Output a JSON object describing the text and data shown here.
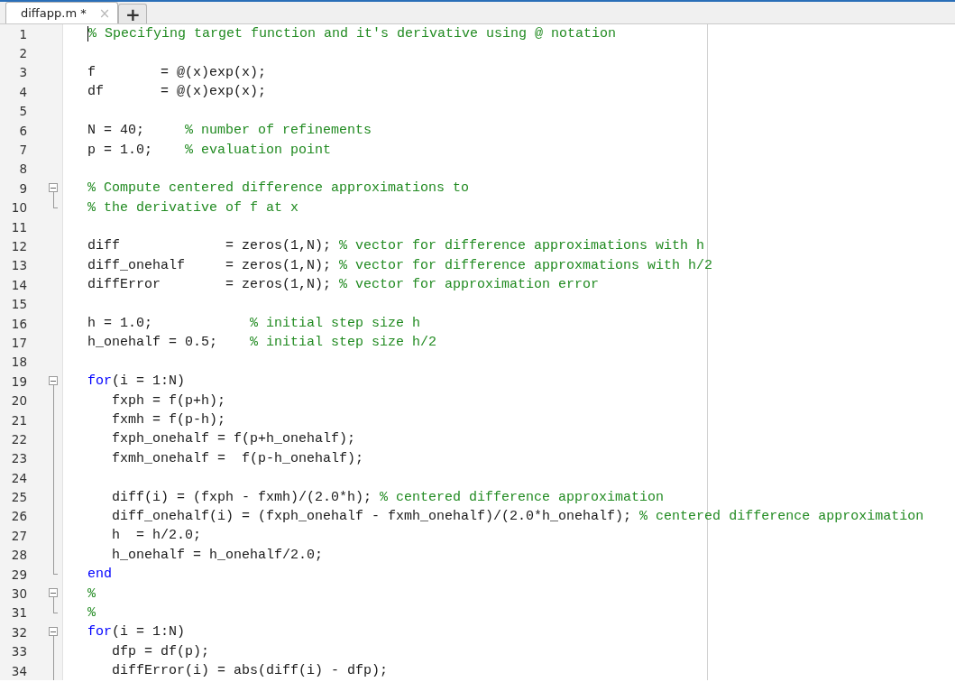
{
  "tabs": [
    {
      "label": "diffapp.m *",
      "selected": true,
      "close": "×"
    }
  ],
  "new_tab": "+",
  "lines": [
    {
      "number": "1",
      "cursor": true,
      "segments": [
        {
          "kind": "comment",
          "text": "% Specifying target function and it's derivative using @ notation"
        }
      ]
    },
    {
      "number": "2"
    },
    {
      "number": "3",
      "segments": [
        {
          "kind": "code",
          "text": "f        = @(x)exp(x);"
        }
      ]
    },
    {
      "number": "4",
      "segments": [
        {
          "kind": "code",
          "text": "df       = @(x)exp(x);"
        }
      ]
    },
    {
      "number": "5"
    },
    {
      "number": "6",
      "segments": [
        {
          "kind": "code",
          "text": "N = 40;     "
        },
        {
          "kind": "comment",
          "text": "% number of refinements"
        }
      ]
    },
    {
      "number": "7",
      "segments": [
        {
          "kind": "code",
          "text": "p = 1.0;    "
        },
        {
          "kind": "comment",
          "text": "% evaluation point"
        }
      ]
    },
    {
      "number": "8"
    },
    {
      "number": "9",
      "kind": "foldstart",
      "segments": [
        {
          "kind": "comment",
          "text": "% Compute centered difference approximations to"
        }
      ]
    },
    {
      "number": "10",
      "kind": "foldend",
      "segments": [
        {
          "kind": "comment",
          "text": "% the derivative of f at x"
        }
      ]
    },
    {
      "number": "11"
    },
    {
      "number": "12",
      "segments": [
        {
          "kind": "code",
          "text": "diff             = zeros(1,N); "
        },
        {
          "kind": "comment",
          "text": "% vector for difference approximations with h"
        }
      ]
    },
    {
      "number": "13",
      "segments": [
        {
          "kind": "code",
          "text": "diff_onehalf     = zeros(1,N); "
        },
        {
          "kind": "comment",
          "text": "% vector for difference approxmations with h/2"
        }
      ]
    },
    {
      "number": "14",
      "segments": [
        {
          "kind": "code",
          "text": "diffError        = zeros(1,N); "
        },
        {
          "kind": "comment",
          "text": "% vector for approximation error"
        }
      ]
    },
    {
      "number": "15"
    },
    {
      "number": "16",
      "segments": [
        {
          "kind": "code",
          "text": "h = 1.0;            "
        },
        {
          "kind": "comment",
          "text": "% initial step size h"
        }
      ]
    },
    {
      "number": "17",
      "segments": [
        {
          "kind": "code",
          "text": "h_onehalf = 0.5;    "
        },
        {
          "kind": "comment",
          "text": "% initial step size h/2"
        }
      ]
    },
    {
      "number": "18"
    },
    {
      "number": "19",
      "kind": "foldstart",
      "segments": [
        {
          "kind": "keyword",
          "text": "for"
        },
        {
          "kind": "code",
          "text": "(i = 1:N)"
        }
      ]
    },
    {
      "number": "20",
      "kind": "foldmid",
      "segments": [
        {
          "kind": "code",
          "text": "   fxph = f(p+h);"
        }
      ]
    },
    {
      "number": "21",
      "kind": "foldmid",
      "segments": [
        {
          "kind": "code",
          "text": "   fxmh = f(p-h);"
        }
      ]
    },
    {
      "number": "22",
      "kind": "foldmid",
      "segments": [
        {
          "kind": "code",
          "text": "   fxph_onehalf = f(p+h_onehalf);"
        }
      ]
    },
    {
      "number": "23",
      "kind": "foldmid",
      "segments": [
        {
          "kind": "code",
          "text": "   fxmh_onehalf =  f(p-h_onehalf);"
        }
      ]
    },
    {
      "number": "24",
      "kind": "foldmid"
    },
    {
      "number": "25",
      "kind": "foldmid",
      "segments": [
        {
          "kind": "code",
          "text": "   diff(i) = (fxph - fxmh)/(2.0*h); "
        },
        {
          "kind": "comment",
          "text": "% centered difference approximation"
        }
      ]
    },
    {
      "number": "26",
      "kind": "foldmid",
      "segments": [
        {
          "kind": "code",
          "text": "   diff_onehalf(i) = (fxph_onehalf - fxmh_onehalf)/(2.0*h_onehalf); "
        },
        {
          "kind": "comment",
          "text": "% centered difference approximation"
        }
      ]
    },
    {
      "number": "27",
      "kind": "foldmid",
      "segments": [
        {
          "kind": "code",
          "text": "   h  = h/2.0;"
        }
      ]
    },
    {
      "number": "28",
      "kind": "foldmid",
      "segments": [
        {
          "kind": "code",
          "text": "   h_onehalf = h_onehalf/2.0;"
        }
      ]
    },
    {
      "number": "29",
      "kind": "foldend",
      "segments": [
        {
          "kind": "keyword",
          "text": "end"
        }
      ]
    },
    {
      "number": "30",
      "kind": "foldstart",
      "segments": [
        {
          "kind": "comment",
          "text": "%"
        }
      ]
    },
    {
      "number": "31",
      "kind": "foldend",
      "segments": [
        {
          "kind": "comment",
          "text": "%"
        }
      ]
    },
    {
      "number": "32",
      "kind": "foldstart",
      "segments": [
        {
          "kind": "keyword",
          "text": "for"
        },
        {
          "kind": "code",
          "text": "(i = 1:N)"
        }
      ]
    },
    {
      "number": "33",
      "kind": "foldmid",
      "segments": [
        {
          "kind": "code",
          "text": "   dfp = df(p);"
        }
      ]
    },
    {
      "number": "34",
      "kind": "foldmid",
      "segments": [
        {
          "kind": "code",
          "text": "   diffError(i) = abs(diff(i) - dfp);"
        }
      ]
    }
  ]
}
